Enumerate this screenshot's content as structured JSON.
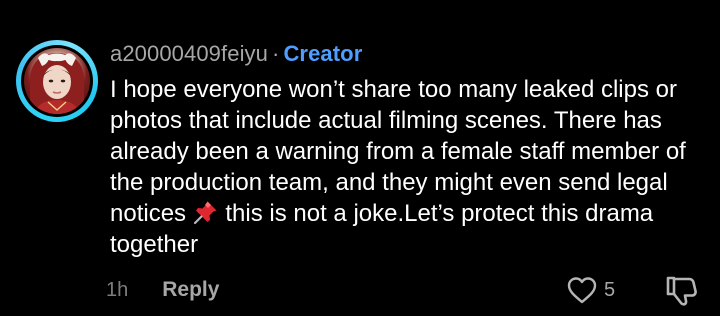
{
  "comment": {
    "username": "a20000409feiyu",
    "separator": "·",
    "badge": "Creator",
    "text_part1": "I hope everyone won’t share too many leaked clips or photos that include actual filming scenes. There has already been a warning from a female staff member of the production team, and they might even send legal notices ",
    "text_part2": " this is not a joke.Let’s protect this drama together",
    "time": "1h",
    "reply_label": "Reply",
    "like_count": "5"
  },
  "icons": {
    "avatar": "avatar",
    "pin": "pushpin-icon",
    "like": "heart-icon",
    "dislike": "thumbs-down-icon"
  },
  "colors": {
    "background": "#000000",
    "text": "#ffffff",
    "muted": "#a7a7a7",
    "creator": "#4f9eff",
    "avatar_ring": "#2fd3f5"
  }
}
